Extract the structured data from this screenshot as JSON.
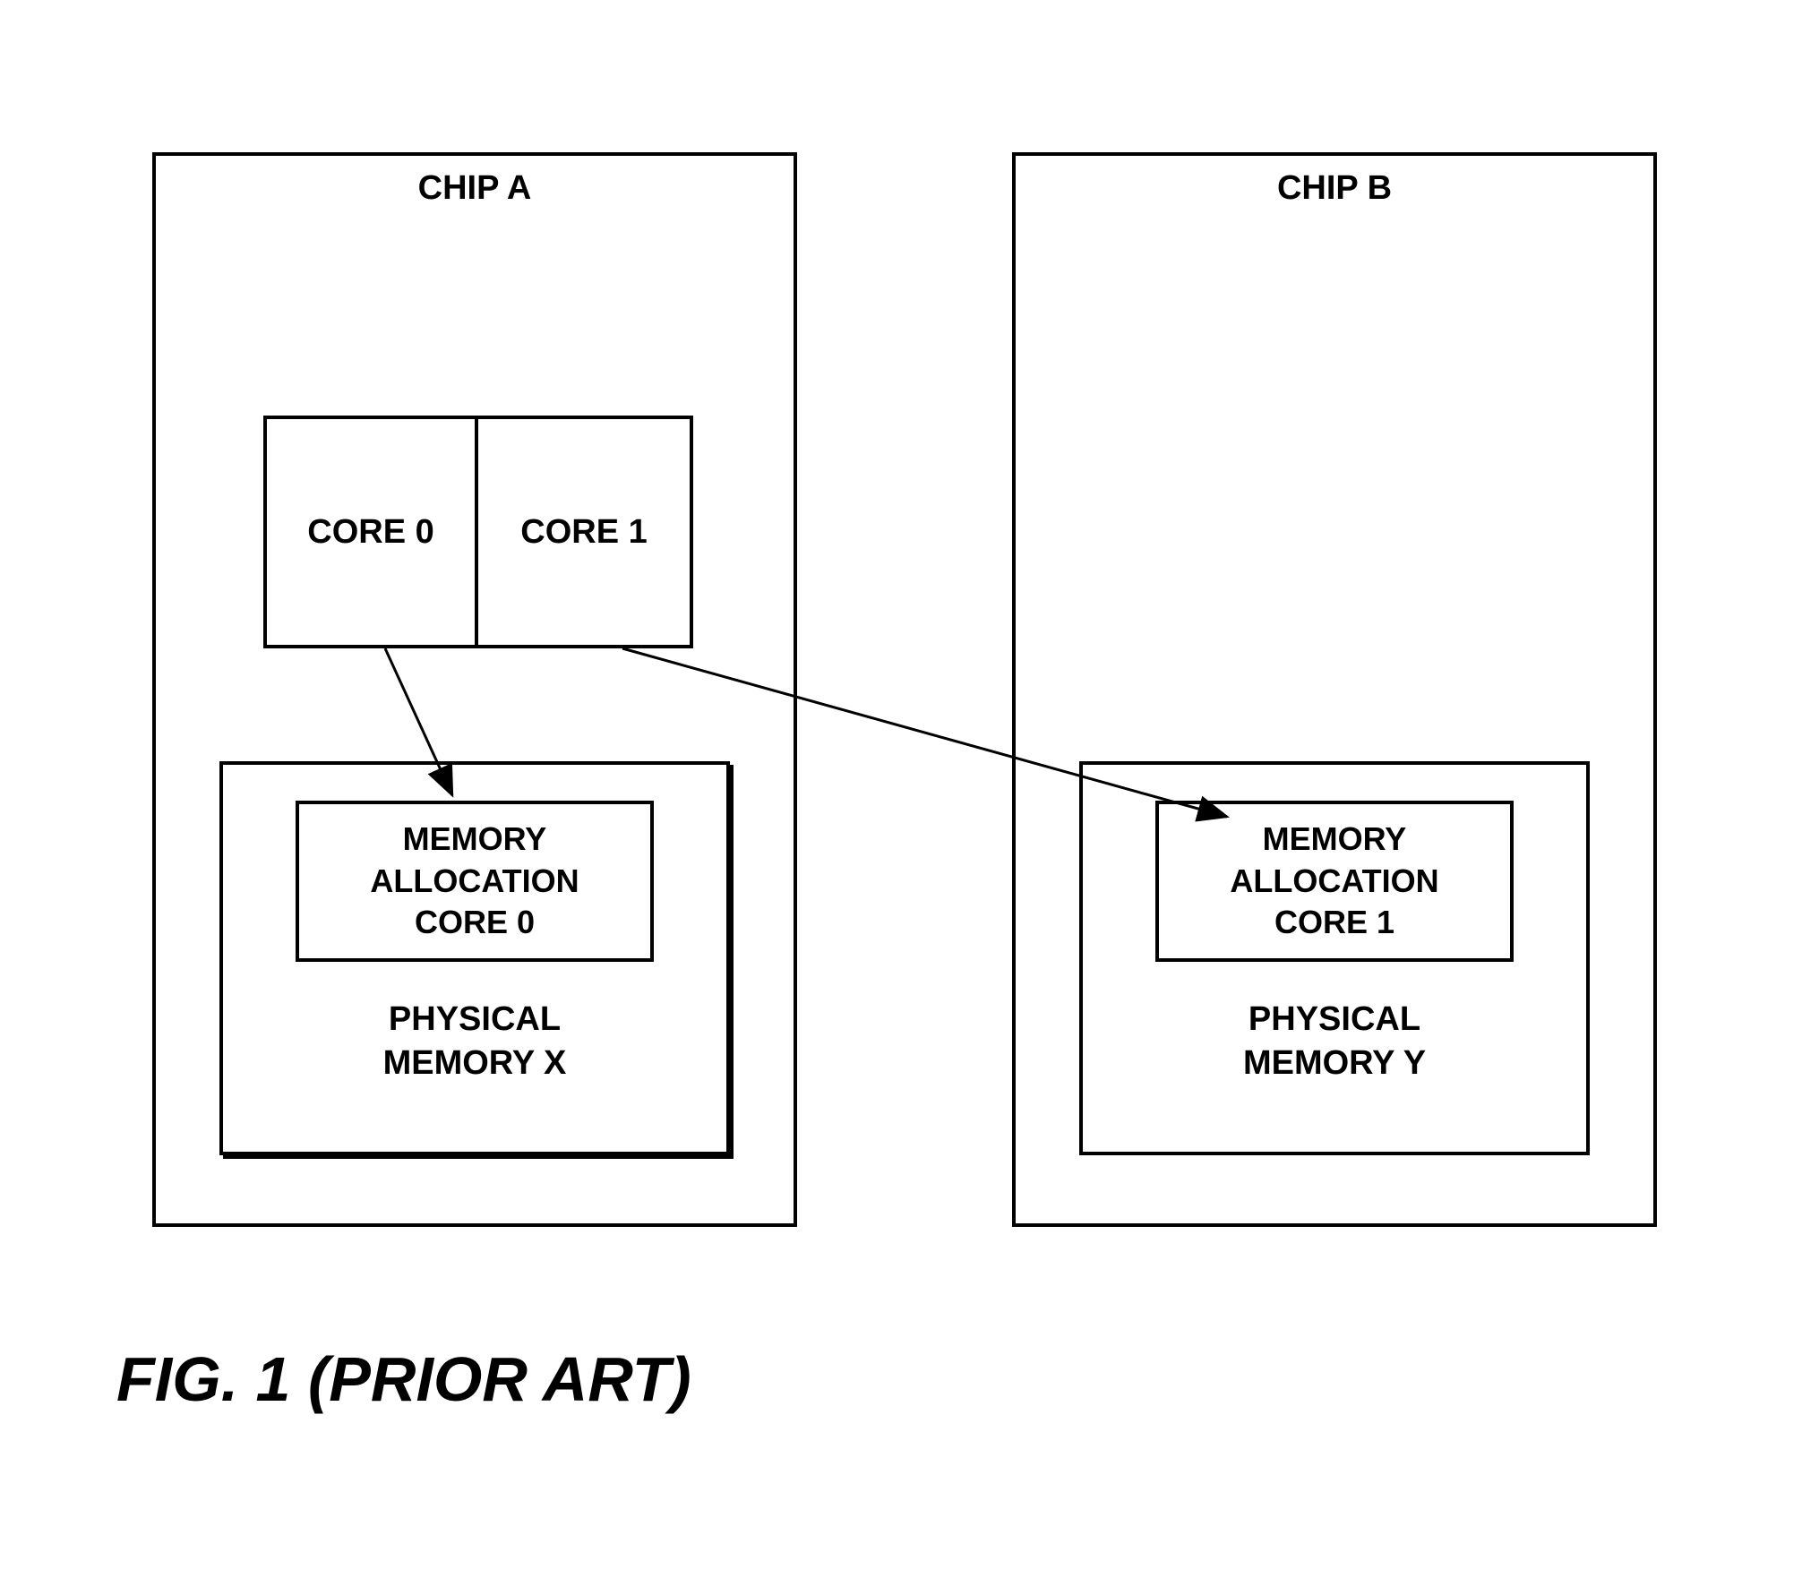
{
  "diagram": {
    "chipA": {
      "label": "CHIP A",
      "core0": "CORE 0",
      "core1": "CORE 1",
      "memoryBlock": {
        "allocation_line1": "MEMORY",
        "allocation_line2": "ALLOCATION",
        "allocation_line3": "CORE 0",
        "label_line1": "PHYSICAL",
        "label_line2": "MEMORY X"
      }
    },
    "chipB": {
      "label": "CHIP B",
      "memoryBlock": {
        "allocation_line1": "MEMORY",
        "allocation_line2": "ALLOCATION",
        "allocation_line3": "CORE 1",
        "label_line1": "PHYSICAL",
        "label_line2": "MEMORY Y"
      }
    },
    "arrows": [
      {
        "from": "core0",
        "to": "memoryX_allocation"
      },
      {
        "from": "core1",
        "to": "memoryY_allocation"
      }
    ]
  },
  "caption": "FIG. 1 (PRIOR ART)"
}
